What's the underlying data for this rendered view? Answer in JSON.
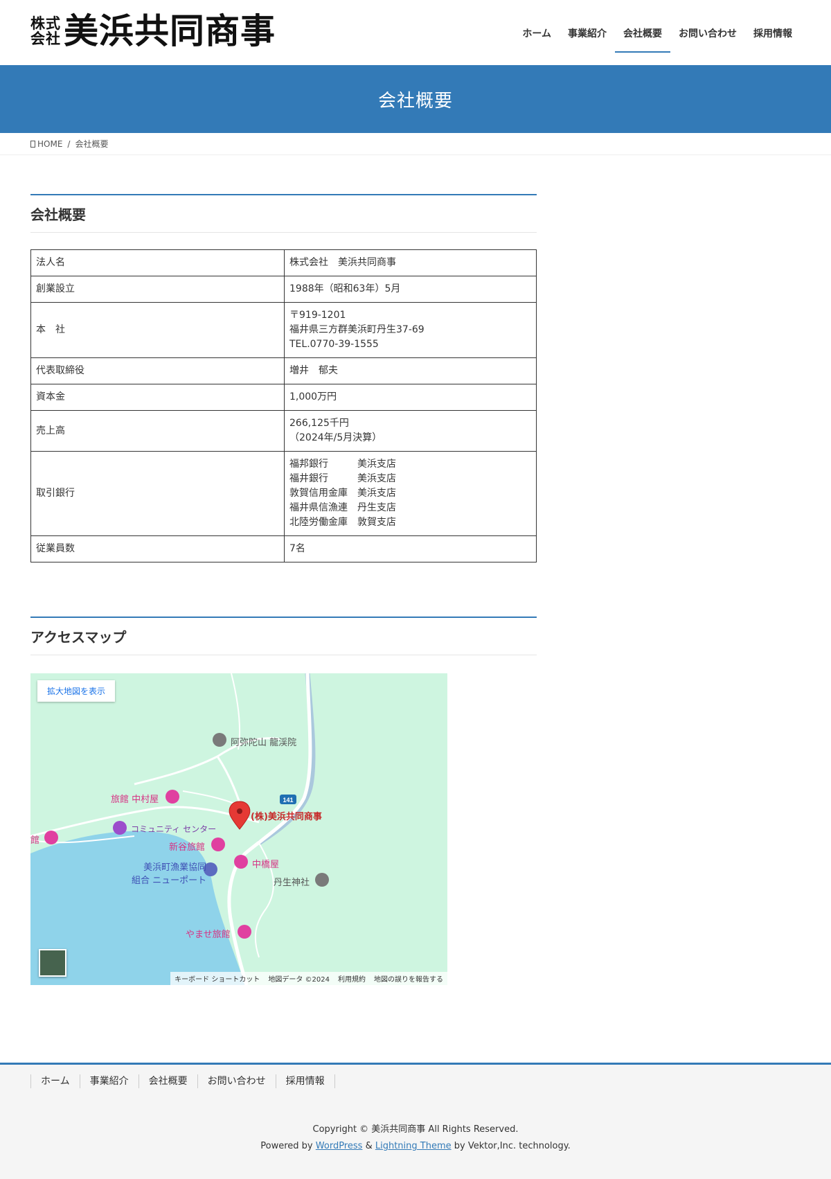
{
  "header": {
    "logo_small_1": "株式",
    "logo_small_2": "会社",
    "logo_main": "美浜共同商事",
    "nav": [
      "ホーム",
      "事業紹介",
      "会社概要",
      "お問い合わせ",
      "採用情報"
    ],
    "active_nav": "会社概要"
  },
  "page_title": "会社概要",
  "breadcrumb": {
    "home": "HOME",
    "separator": "/",
    "current": "会社概要"
  },
  "company_section": {
    "title": "会社概要",
    "rows": [
      {
        "label": "法人名",
        "value": "株式会社　美浜共同商事"
      },
      {
        "label": "創業設立",
        "value": "1988年（昭和63年）5月"
      },
      {
        "label": "本　社",
        "lines": [
          "〒919-1201",
          "福井県三方群美浜町丹生37-69",
          "TEL.0770-39-1555"
        ]
      },
      {
        "label": "代表取締役",
        "value": "増井　郁夫"
      },
      {
        "label": "資本金",
        "value": "1,000万円"
      },
      {
        "label": "売上高",
        "lines": [
          "266,125千円",
          "（2024年/5月決算）"
        ]
      },
      {
        "label": "取引銀行",
        "banks": [
          {
            "name": "福邦銀行",
            "branch": "美浜支店"
          },
          {
            "name": "福井銀行",
            "branch": "美浜支店"
          },
          {
            "name": "敦賀信用金庫",
            "branch": "美浜支店"
          },
          {
            "name": "福井県信漁連",
            "branch": "丹生支店"
          },
          {
            "name": "北陸労働金庫",
            "branch": "敦賀支店"
          }
        ]
      },
      {
        "label": "従業員数",
        "value": "7名"
      }
    ]
  },
  "access_section": {
    "title": "アクセスマップ",
    "map": {
      "enlarge_button": "拡大地図を表示",
      "labels": {
        "temple": "阿弥陀山 龍渓院",
        "ryokan_nakamura": "旅館 中村屋",
        "community": "コミュニティ センター",
        "shintani": "新谷旅館",
        "gyokyo_1": "美浜町漁業協同",
        "gyokyo_2": "組合 ニューポート",
        "nakahashi": "中橋屋",
        "shrine": "丹生神社",
        "yamase": "やませ旅館",
        "company_pin": "(株)美浜共同商事",
        "edge": "館",
        "route": "141"
      },
      "attribution": [
        "キーボード ショートカット",
        "地図データ ©2024",
        "利用規約",
        "地図の誤りを報告する"
      ]
    }
  },
  "footer": {
    "nav": [
      "ホーム",
      "事業紹介",
      "会社概要",
      "お問い合わせ",
      "採用情報"
    ],
    "copyright": "Copyright © 美浜共同商事 All Rights Reserved.",
    "powered_prefix": "Powered by",
    "wordpress": "WordPress",
    "amp": "&",
    "theme": "Lightning Theme",
    "powered_suffix": "by Vektor,Inc. technology."
  },
  "colors": {
    "accent": "#337ab7",
    "map_land": "#cef5e0",
    "map_water": "#8fd3ea",
    "pin": "#e53935",
    "poi": "#e040a0"
  }
}
